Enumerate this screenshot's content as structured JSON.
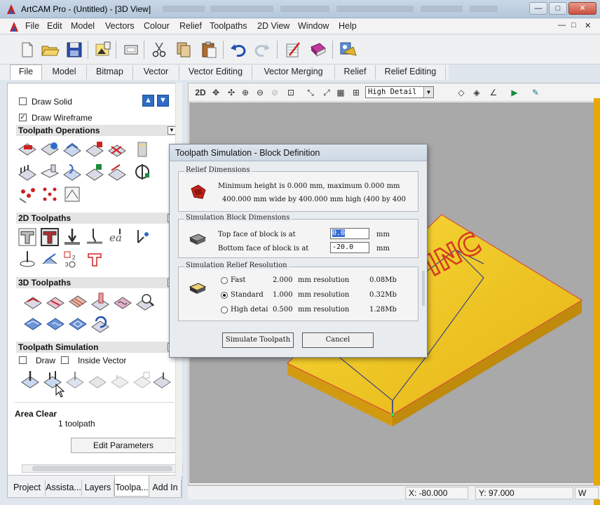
{
  "window": {
    "title": "ArtCAM Pro - (Untitled) - [3D View]",
    "controls": [
      "—",
      "□",
      "✕"
    ],
    "inner_controls": [
      "—",
      "□",
      "✕"
    ]
  },
  "menubar": [
    "File",
    "Edit",
    "Model",
    "Vectors",
    "Colour",
    "Relief",
    "Toolpaths",
    "2D View",
    "Window",
    "Help"
  ],
  "tabs": [
    "File",
    "Model",
    "Bitmap",
    "Vector",
    "Vector Editing",
    "Vector Merging",
    "Relief",
    "Relief Editing"
  ],
  "left_panel": {
    "draw_solid": "Draw Solid",
    "draw_wireframe": "Draw Wireframe",
    "sections": {
      "toolpath_operations": "Toolpath Operations",
      "toolpaths_2d": "2D Toolpaths",
      "toolpaths_3d": "3D Toolpaths",
      "toolpath_simulation": "Toolpath Simulation"
    },
    "sim_draw": "Draw",
    "sim_inside_vector": "Inside Vector",
    "area_clear": "Area Clear",
    "toolpath_count": "1 toolpath",
    "edit_parameters": "Edit Parameters",
    "bottom_tabs": [
      "Project",
      "Assista...",
      "Layers",
      "Toolpa...",
      "Add In"
    ],
    "arrow_up": "▲",
    "arrow_down": "▼"
  },
  "view3d": {
    "mode": "2D",
    "detail": "High Detail",
    "status_x": "X: -80.000",
    "status_y": "Y: 97.000",
    "status_w": "W"
  },
  "dialog": {
    "title": "Toolpath Simulation - Block Definition",
    "relief_dimensions": {
      "label": "Relief Dimensions",
      "line1": "Minimum height is 0.000 mm, maximum 0.000 mm",
      "line2": "400.000 mm wide by 400.000 mm high (400 by 400"
    },
    "block_dimensions": {
      "label": "Simulation Block Dimensions",
      "top_label": "Top face of block is at",
      "top_value": "0.0",
      "bottom_label": "Bottom face of block is at",
      "bottom_value": "-20.0",
      "unit": "mm"
    },
    "resolution": {
      "label": "Simulation Relief Resolution",
      "options": [
        {
          "name": "Fast",
          "value": "2.000",
          "text": "mm resolution",
          "size": "0.08Mb",
          "selected": false
        },
        {
          "name": "Standard",
          "value": "1.000",
          "text": "mm resolution",
          "size": "0.32Mb",
          "selected": true
        },
        {
          "name": "High detai",
          "value": "0.500",
          "text": "mm resolution",
          "size": "1.28Mb",
          "selected": false
        }
      ]
    },
    "simulate_button": "Simulate Toolpath",
    "cancel_button": "Cancel"
  }
}
